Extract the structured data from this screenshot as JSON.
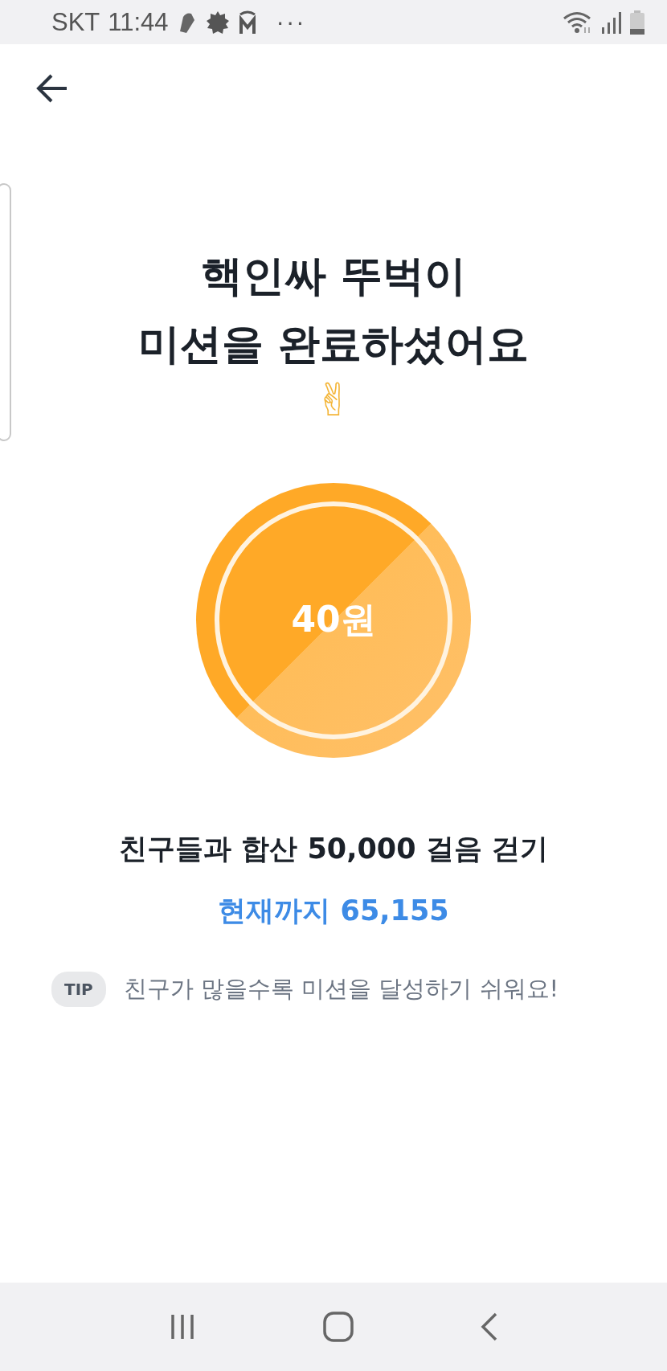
{
  "status_bar": {
    "carrier": "SKT",
    "time": "11:44",
    "more": "···"
  },
  "title_lines": [
    "핵인싸 뚜벅이",
    "미션을 완료하셨어요"
  ],
  "emoji": "✌",
  "reward": {
    "amount": "40원"
  },
  "mission": {
    "goal": "친구들과 합산 50,000 걸음 걷기",
    "progress": "현재까지 65,155"
  },
  "tip": {
    "badge": "TIP",
    "text": "친구가 많을수록 미션을 달성하기 쉬워요!"
  }
}
